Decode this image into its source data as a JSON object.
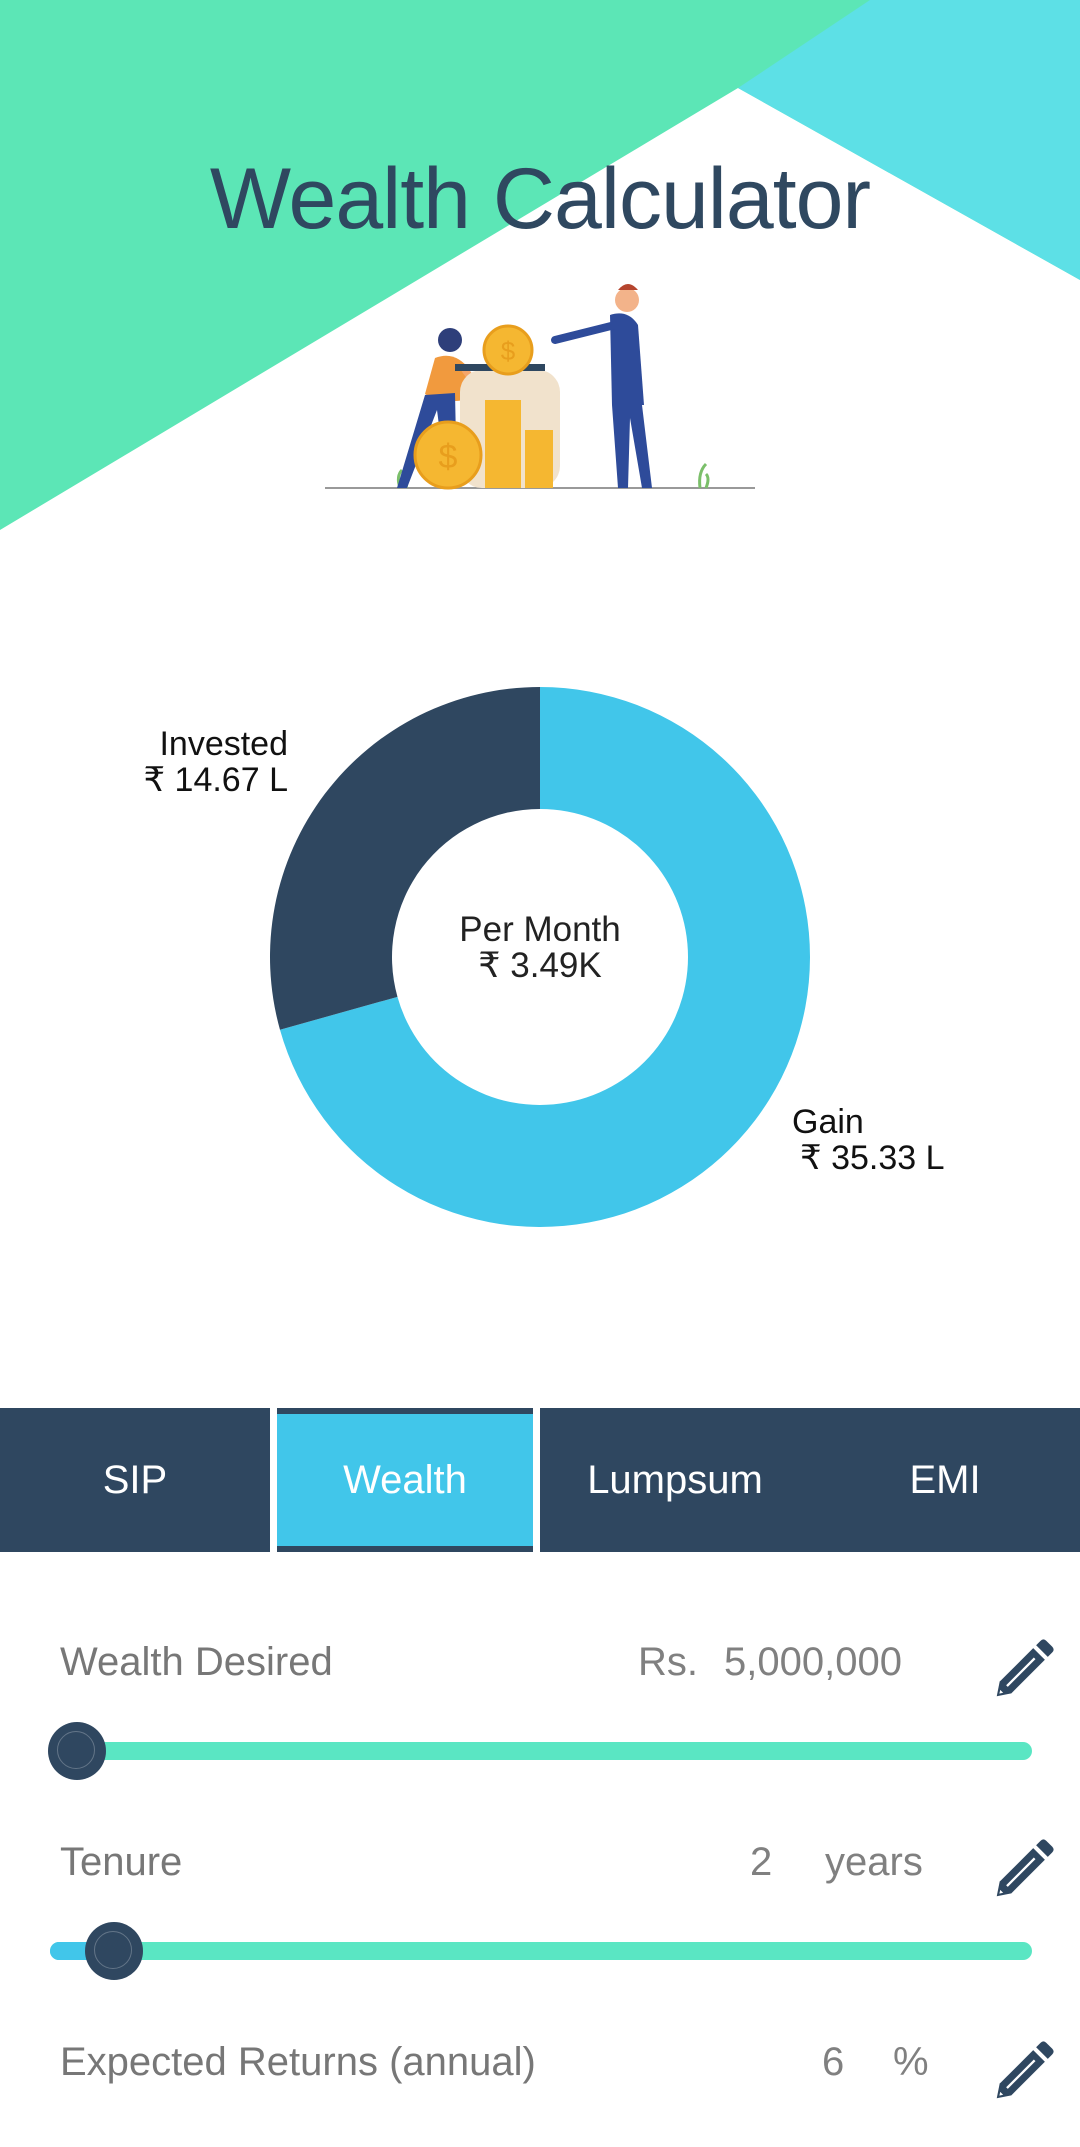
{
  "header": {
    "title": "Wealth Calculator",
    "colors": {
      "green": "#5ce6b6",
      "cyan": "#5de0e6",
      "title": "#2f4860"
    }
  },
  "illustration": {
    "name": "people-saving-coins-jar"
  },
  "chart_data": {
    "type": "pie",
    "variant": "donut",
    "center_label": "Per Month",
    "center_value": "₹  3.49K",
    "slices": [
      {
        "name": "Gain",
        "display": "₹  35.33 L",
        "value": 35.33,
        "unit": "L",
        "color": "#41c6ea"
      },
      {
        "name": "Invested",
        "display": "₹  14.67 L",
        "value": 14.67,
        "unit": "L",
        "color": "#2f4760"
      }
    ],
    "start": "top",
    "direction": "clockwise"
  },
  "tabs": [
    {
      "label": "SIP",
      "active": false
    },
    {
      "label": "Wealth",
      "active": true
    },
    {
      "label": "Lumpsum",
      "active": false
    },
    {
      "label": "EMI",
      "active": false
    }
  ],
  "form": {
    "wealth": {
      "label": "Wealth Desired",
      "prefix": "Rs.",
      "value": "5,000,000",
      "slider_fraction": 0.0
    },
    "tenure": {
      "label": "Tenure",
      "value": "2",
      "suffix": "years",
      "slider_fraction": 0.02
    },
    "returns": {
      "label": "Expected Returns (annual)",
      "value": "6",
      "suffix": "%"
    }
  },
  "icons": {
    "edit": "pencil-icon"
  }
}
